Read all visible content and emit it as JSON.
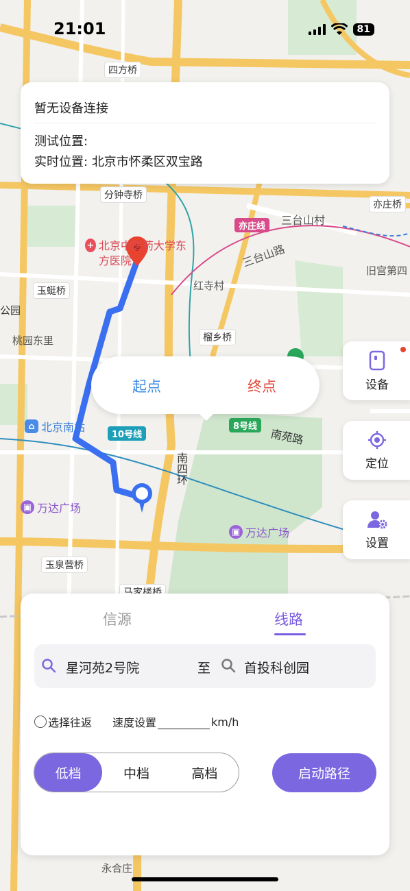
{
  "status_bar": {
    "time": "21:01",
    "battery": "81"
  },
  "info_card": {
    "device_status": "暂无设备连接",
    "test_location_label": "测试位置:",
    "realtime_location_label": "实时位置:",
    "realtime_location_value": "北京市怀柔区双宝路"
  },
  "popup": {
    "start_label": "起点",
    "end_label": "终点"
  },
  "side_buttons": {
    "device": "设备",
    "locate": "定位",
    "settings": "设置"
  },
  "panel": {
    "tabs": {
      "source": "信源",
      "route": "线路"
    },
    "route": {
      "from": "星河苑2号院",
      "separator": "至",
      "to": "首投科创园"
    },
    "round_trip_label": "选择往返",
    "speed_label": "速度设置",
    "speed_value": "",
    "speed_unit": "km/h",
    "gears": [
      "低档",
      "中档",
      "高档"
    ],
    "active_gear": "低档",
    "start_route_label": "启动路径"
  },
  "map": {
    "labels": {
      "sifang_bridge": "四方桥",
      "fenzhongsi_bridge": "分钟寺桥",
      "yizhuang_bridge": "亦庄桥",
      "santai_village": "三台山村",
      "santai_road": "三台山路",
      "jiugong": "旧宫第四",
      "hospital": "北京中医药大学东方医院",
      "yuting_bridge": "玉蜓桥",
      "hongsi_village": "红寺村",
      "liuxiang_bridge": "榴乡桥",
      "park": "公园",
      "taoyuan": "桃园东里",
      "beijing_south": "北京南站",
      "line10": "10号线",
      "line8": "8号线",
      "line_yizhuang": "亦庄线",
      "nanyuan_road": "南苑路",
      "south_4th_ring": "南四环",
      "wanda1": "万达广场",
      "wanda2": "万达广场",
      "yuquanying_bridge": "玉泉营桥",
      "majialou_bridge": "马家楼桥",
      "yonghezhuang": "永合庄"
    },
    "colors": {
      "route": "#3a6ff0",
      "destination_pin": "#e8432f",
      "accent": "#7b68e0"
    }
  }
}
